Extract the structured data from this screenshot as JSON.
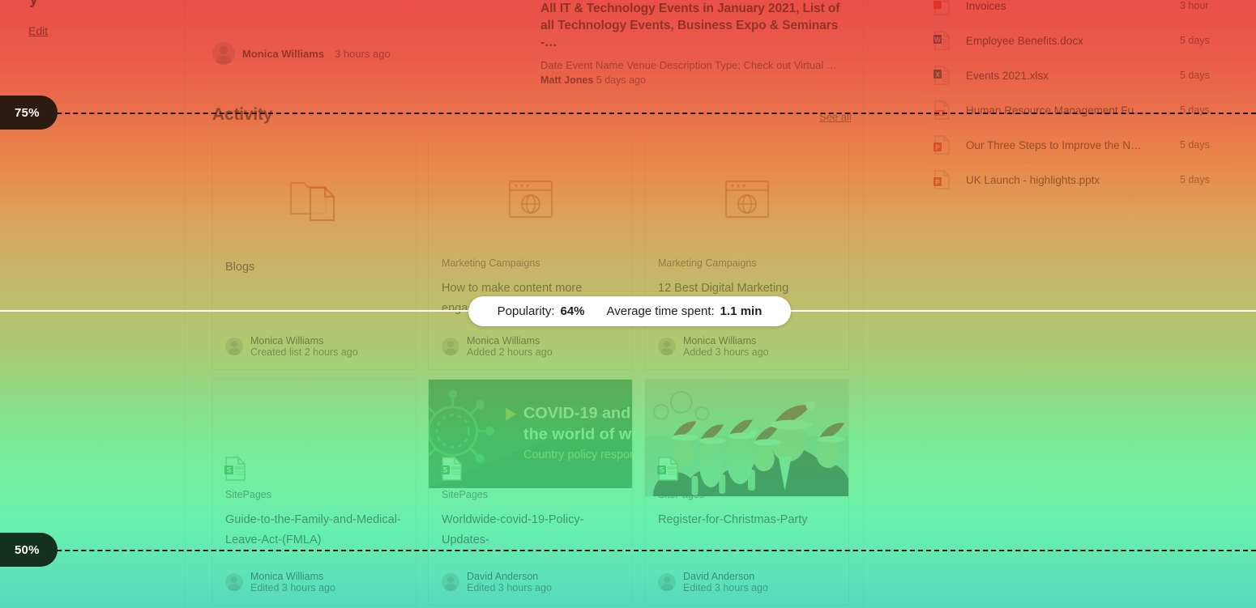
{
  "page": {
    "cut_letter": "y",
    "edit_label": "Edit"
  },
  "news": {
    "title": "All IT & Technology Events in January 2021, List of all Technology Events, Business Expo & Seminars -…",
    "description": "Date Event Name Venue Description Type; Check out Virtual …",
    "author": "Matt Jones",
    "time": "5 days ago"
  },
  "person_row": {
    "name": "Monica Williams",
    "time": "3 hours ago"
  },
  "activity": {
    "heading": "Activity",
    "see_all": "See all",
    "cards": [
      {
        "kicker": "",
        "title": "Blogs",
        "icon": "list-document-icon",
        "author": "Monica Williams",
        "sub": "Created list 2 hours ago"
      },
      {
        "kicker": "Marketing Campaigns",
        "title": "How to make content more engaging",
        "icon": "browser-globe-icon",
        "author": "Monica Williams",
        "sub": "Added 2 hours ago"
      },
      {
        "kicker": "Marketing Campaigns",
        "title": "12 Best Digital Marketing",
        "icon": "browser-globe-icon",
        "author": "Monica Williams",
        "sub": "Added 3 hours ago"
      },
      {
        "kicker": "SitePages",
        "title": "Guide-to-the-Family-and-Medical-Leave-Act-(FMLA)",
        "icon": "sharepoint-page-icon",
        "author": "Monica Williams",
        "sub": "Edited 3 hours ago"
      },
      {
        "kicker": "SitePages",
        "title": "Worldwide-covid-19-Policy-Updates-",
        "icon": "sharepoint-page-icon",
        "thumb_title": "COVID-19 and",
        "thumb_title2": "the world of work",
        "thumb_sub": "Country policy responses",
        "author": "David Anderson",
        "sub": "Edited 3 hours ago"
      },
      {
        "kicker": "SitePages",
        "title": "Register-for-Christmas-Party",
        "icon": "sharepoint-page-icon",
        "author": "David Anderson",
        "sub": "Edited 3 hours ago"
      }
    ]
  },
  "files": [
    {
      "name": "Invoices",
      "date": "3 hour",
      "icon": "excel-icon"
    },
    {
      "name": "Employee Benefits.docx",
      "date": "5 days",
      "icon": "word-icon"
    },
    {
      "name": "Events 2021.xlsx",
      "date": "5 days",
      "icon": "excel-icon"
    },
    {
      "name": "Human Resource Management Fu…",
      "date": "5 days",
      "icon": "pdf-icon"
    },
    {
      "name": "Our Three Steps to Improve the N…",
      "date": "5 days",
      "icon": "powerpoint-icon"
    },
    {
      "name": "UK Launch - highlights.pptx",
      "date": "5 days",
      "icon": "powerpoint-icon"
    }
  ],
  "heatmap": {
    "tooltip": {
      "popularity_label": "Popularity:",
      "popularity_value": "64%",
      "time_label": "Average time spent:",
      "time_value": "1.1 min"
    },
    "scale_markers": [
      {
        "label": "75%",
        "color": "#2d1a10"
      },
      {
        "label": "50%",
        "color": "#14301f"
      }
    ],
    "colors": {
      "hot": "#e8453c",
      "mid": "#e8803f",
      "warm": "#bbbb63",
      "cool": "#74e78e",
      "cold": "#4fd6b8"
    }
  }
}
